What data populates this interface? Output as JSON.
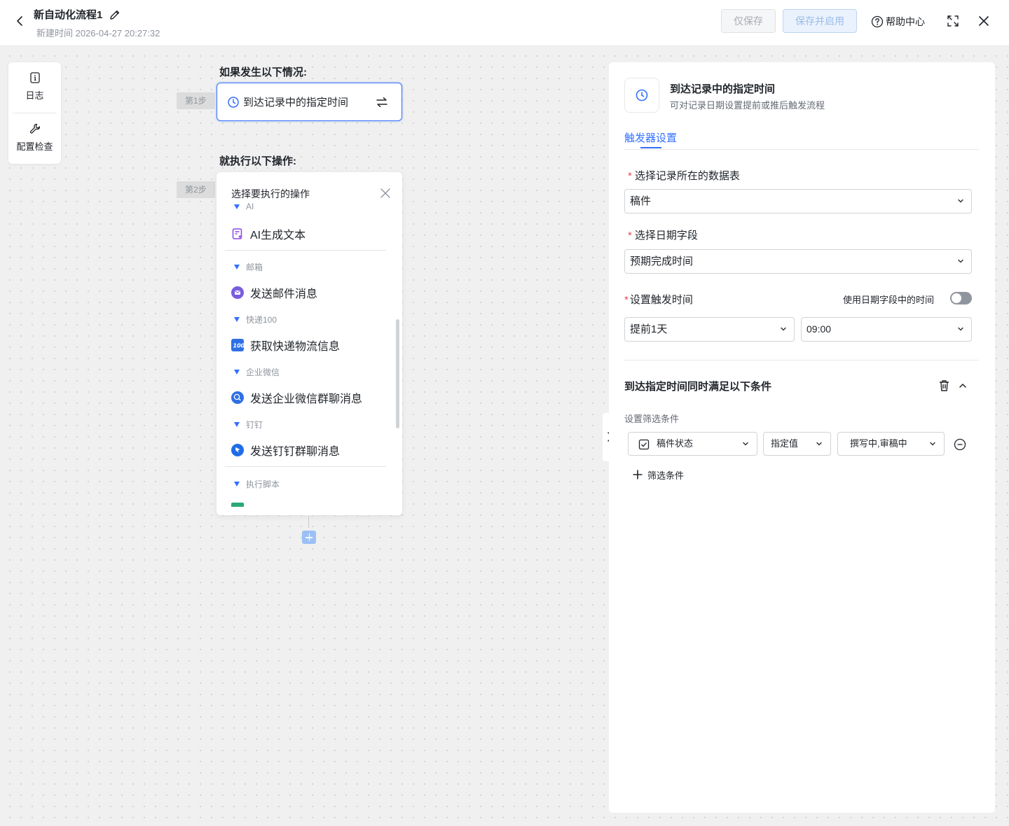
{
  "header": {
    "title": "新自动化流程1",
    "created_time": "新建时间 2026-04-27 20:27:32",
    "save_only_label": "仅保存",
    "save_enable_label": "保存并启用",
    "help_label": "帮助中心"
  },
  "side_tools": {
    "log_label": "日志",
    "check_label": "配置检查"
  },
  "flow": {
    "if_label": "如果发生以下情况:",
    "then_label": "就执行以下操作:",
    "step1_badge": "第1步",
    "step2_badge": "第2步",
    "trigger_text": "到达记录中的指定时间"
  },
  "picker": {
    "title": "选择要执行的操作",
    "groups": [
      {
        "label": "AI",
        "item": "AI生成文本"
      },
      {
        "label": "邮箱",
        "item": "发送邮件消息"
      },
      {
        "label": "快递100",
        "item": "获取快递物流信息"
      },
      {
        "label": "企业微信",
        "item": "发送企业微信群聊消息"
      },
      {
        "label": "钉钉",
        "item": "发送钉钉群聊消息"
      },
      {
        "label": "执行脚本",
        "item": ""
      }
    ]
  },
  "panel": {
    "title": "到达记录中的指定时间",
    "subtitle": "可对记录日期设置提前或推后触发流程",
    "tab": "触发器设置",
    "table_label": "选择记录所在的数据表",
    "table_value": "稿件",
    "date_field_label": "选择日期字段",
    "date_field_value": "预期完成时间",
    "trigger_time_label": "设置触发时间",
    "use_field_time_label": "使用日期字段中的时间",
    "use_field_time_on": false,
    "offset_value": "提前1天",
    "time_value": "09:00",
    "condition_title": "到达指定时间同时满足以下条件",
    "filter_label": "设置筛选条件",
    "filter": {
      "field": "稿件状态",
      "operator": "指定值",
      "value": "撰写中,审稿中"
    },
    "add_filter_label": "筛选条件"
  },
  "colors": {
    "accent": "#3370ff",
    "required": "#e34d59"
  }
}
